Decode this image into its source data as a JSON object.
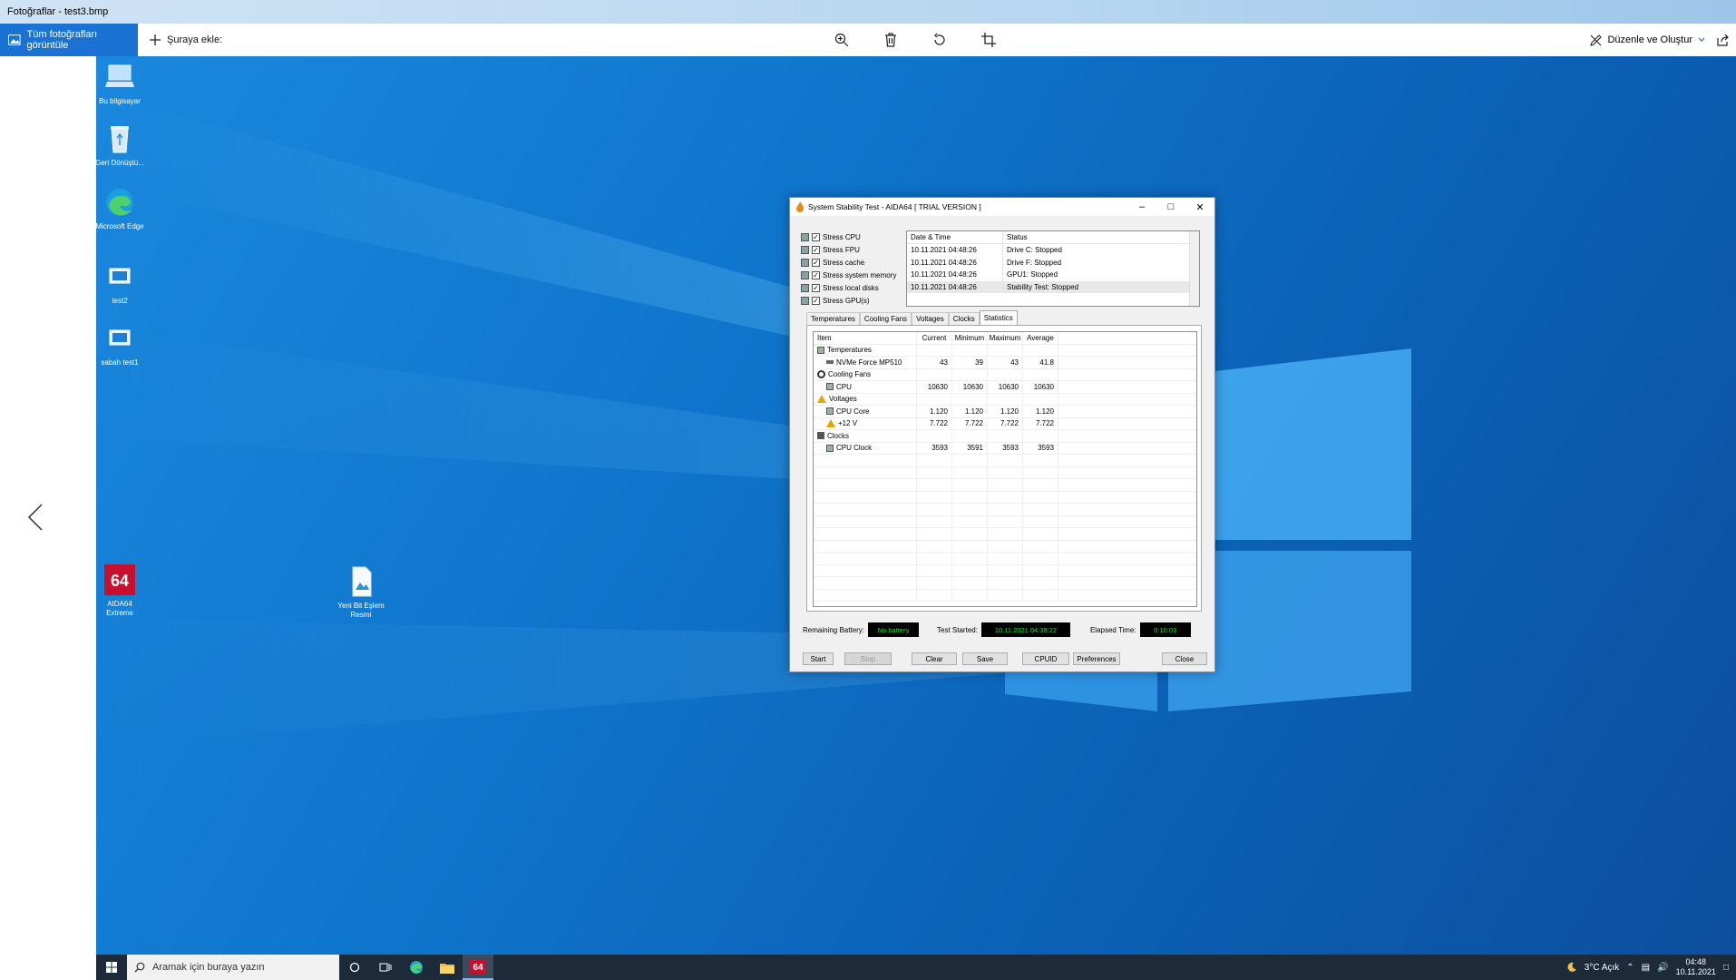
{
  "app": {
    "title": "Fotoğraflar - test3.bmp"
  },
  "toolbar": {
    "view_all": "Tüm fotoğrafları görüntüle",
    "add_to": "Şuraya ekle:",
    "edit_create": "Düzenle ve Oluştur",
    "icons": [
      "zoom-icon",
      "trash-icon",
      "rotate-icon",
      "crop-icon",
      "share-icon"
    ]
  },
  "desktop": {
    "icons": [
      "Bu bilgisayar",
      "Geri Dönüştü...",
      "Microsoft Edge",
      "test2",
      "sabah test1",
      "AIDA64 Extreme",
      "Yeni Bit Eşlem Resmi"
    ]
  },
  "aida": {
    "title": "System Stability Test - AIDA64  [ TRIAL VERSION ]",
    "stress": [
      "Stress CPU",
      "Stress FPU",
      "Stress cache",
      "Stress system memory",
      "Stress local disks",
      "Stress GPU(s)"
    ],
    "log": {
      "head": [
        "Date & Time",
        "Status"
      ],
      "rows": [
        [
          "10.11.2021 04:48:26",
          "Drive C: Stopped"
        ],
        [
          "10.11.2021 04:48:26",
          "Drive F: Stopped"
        ],
        [
          "10.11.2021 04:48:26",
          "GPU1: Stopped"
        ],
        [
          "10.11.2021 04:48:26",
          "Stability Test: Stopped"
        ]
      ]
    },
    "tabs": [
      "Temperatures",
      "Cooling Fans",
      "Voltages",
      "Clocks",
      "Statistics"
    ],
    "stats": {
      "head": [
        "Item",
        "Current",
        "Minimum",
        "Maximum",
        "Average"
      ],
      "rows": [
        [
          "Temperatures",
          "",
          "",
          "",
          ""
        ],
        [
          "NVMe Force MP510",
          "43",
          "39",
          "43",
          "41.8"
        ],
        [
          "Cooling Fans",
          "",
          "",
          "",
          ""
        ],
        [
          "CPU",
          "10630",
          "10630",
          "10630",
          "10630"
        ],
        [
          "Voltages",
          "",
          "",
          "",
          ""
        ],
        [
          "CPU Core",
          "1.120",
          "1.120",
          "1.120",
          "1.120"
        ],
        [
          "+12 V",
          "7.722",
          "7.722",
          "7.722",
          "7.722"
        ],
        [
          "Clocks",
          "",
          "",
          "",
          ""
        ],
        [
          "CPU Clock",
          "3593",
          "3591",
          "3593",
          "3593"
        ]
      ]
    },
    "status": {
      "battery_label": "Remaining Battery:",
      "battery_value": "No battery",
      "started_label": "Test Started:",
      "started_value": "10.11.2021 04:38:22",
      "elapsed_label": "Elapsed Time:",
      "elapsed_value": "0:10:03"
    },
    "buttons": [
      "Start",
      "Stop",
      "Clear",
      "Save",
      "CPUID",
      "Preferences",
      "Close"
    ]
  },
  "taskbar": {
    "search": "Aramak için buraya yazın",
    "weather": "3°C  Açık",
    "time": "04:48",
    "date": "10.11.2021"
  }
}
